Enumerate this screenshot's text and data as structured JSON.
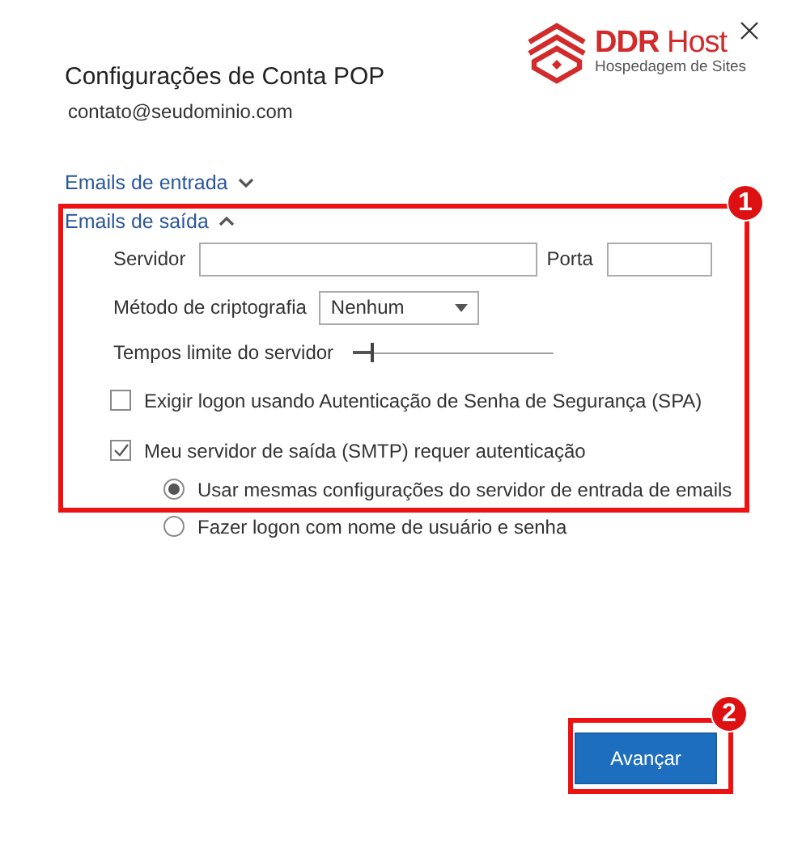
{
  "logo": {
    "name": "DDR Host",
    "tagline": "Hospedagem de Sites"
  },
  "title": "Configurações de Conta POP",
  "account": "contato@seudominio.com",
  "sections": [
    {
      "label": "Emails de entrada",
      "expanded": false
    },
    {
      "label": "Emails de saída",
      "expanded": true
    }
  ],
  "server": {
    "label": "Servidor"
  },
  "port": {
    "label": "Porta"
  },
  "encryption": {
    "label": "Método de criptografia",
    "value": "Nenhum"
  },
  "timeout": {
    "label": "Tempos limite do servidor",
    "level": 0.1
  },
  "checkboxes": [
    {
      "label": "Exigir logon usando Autenticação de Senha de Segurança (SPA)",
      "checked": false
    },
    {
      "label": "Meu servidor de saída (SMTP) requer autenticação",
      "checked": true
    }
  ],
  "radios": [
    {
      "label": "Usar mesmas configurações do servidor de entrada de emails",
      "selected": true
    },
    {
      "label": "Fazer logon com nome de usuário e senha",
      "selected": false
    }
  ],
  "button": "Avançar",
  "annotations": [
    {
      "number": "1"
    },
    {
      "number": "2"
    }
  ]
}
